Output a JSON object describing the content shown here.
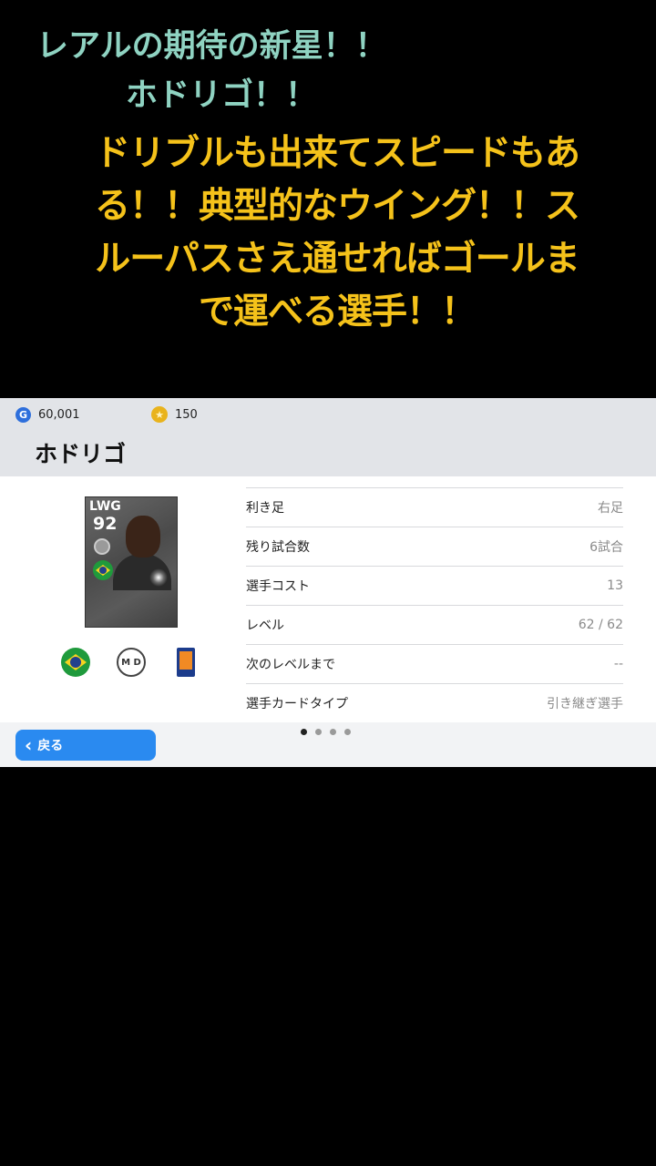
{
  "captions": {
    "line1": "レアルの期待の新星！！",
    "line2": "ホドリゴ！！",
    "line3": "ドリブルも出来てスピードもある！！典型的なウイング！！スルーパスさえ通せればゴールまで運べる選手！！"
  },
  "currency": {
    "gp": "60,001",
    "coins": "150",
    "gp_icon_label": "G",
    "coin_icon_label": "★"
  },
  "player": {
    "name": "ホドリゴ",
    "position": "LWG",
    "overall": "92",
    "club_icon_label": "M D"
  },
  "stats": [
    {
      "label": "利き足",
      "value": "右足"
    },
    {
      "label": "残り試合数",
      "value": "6試合"
    },
    {
      "label": "選手コスト",
      "value": "13"
    },
    {
      "label": "レベル",
      "value": "62 / 62"
    },
    {
      "label": "次のレベルまで",
      "value": "--"
    },
    {
      "label": "選手カードタイプ",
      "value": "引き継ぎ選手"
    }
  ],
  "pagination": {
    "total": 4,
    "current": 1
  },
  "back_button": {
    "label": "戻る"
  },
  "colors": {
    "caption_teal": "#8fd3c2",
    "caption_yellow": "#f5c21a",
    "button_blue": "#2a8af0"
  }
}
